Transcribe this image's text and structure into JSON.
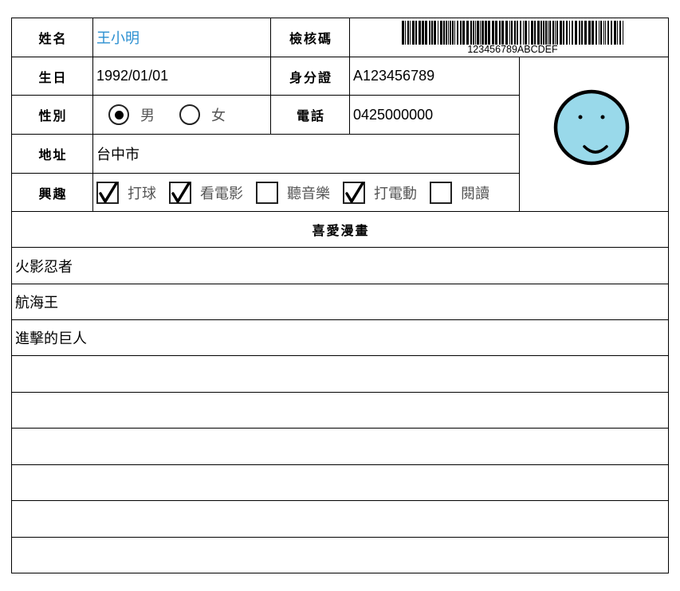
{
  "form": {
    "name": {
      "label": "姓名",
      "value": "王小明"
    },
    "check_code": {
      "label": "檢核碼",
      "barcode_text": "123456789ABCDEF"
    },
    "birthday": {
      "label": "生日",
      "value": "1992/01/01"
    },
    "id_number": {
      "label": "身分證",
      "value": "A123456789"
    },
    "gender": {
      "label": "性別",
      "options": [
        {
          "label": "男",
          "selected": true
        },
        {
          "label": "女",
          "selected": false
        }
      ]
    },
    "phone": {
      "label": "電話",
      "value": "0425000000"
    },
    "address": {
      "label": "地址",
      "value": "台中市"
    },
    "hobbies": {
      "label": "興趣",
      "options": [
        {
          "label": "打球",
          "checked": true
        },
        {
          "label": "看電影",
          "checked": true
        },
        {
          "label": "聽音樂",
          "checked": false
        },
        {
          "label": "打電動",
          "checked": true
        },
        {
          "label": "閱讀",
          "checked": false
        }
      ]
    },
    "photo": {
      "icon": "smiley-face-icon"
    }
  },
  "comics": {
    "header": "喜愛漫畫",
    "items": [
      "火影忍者",
      "航海王",
      "進擊的巨人",
      "",
      "",
      "",
      "",
      "",
      ""
    ]
  },
  "colors": {
    "name_value": "#2b8fd1",
    "avatar_fill": "#99d9ea",
    "avatar_outline": "#000000",
    "option_text": "#555555",
    "grid_line": "#000000"
  }
}
